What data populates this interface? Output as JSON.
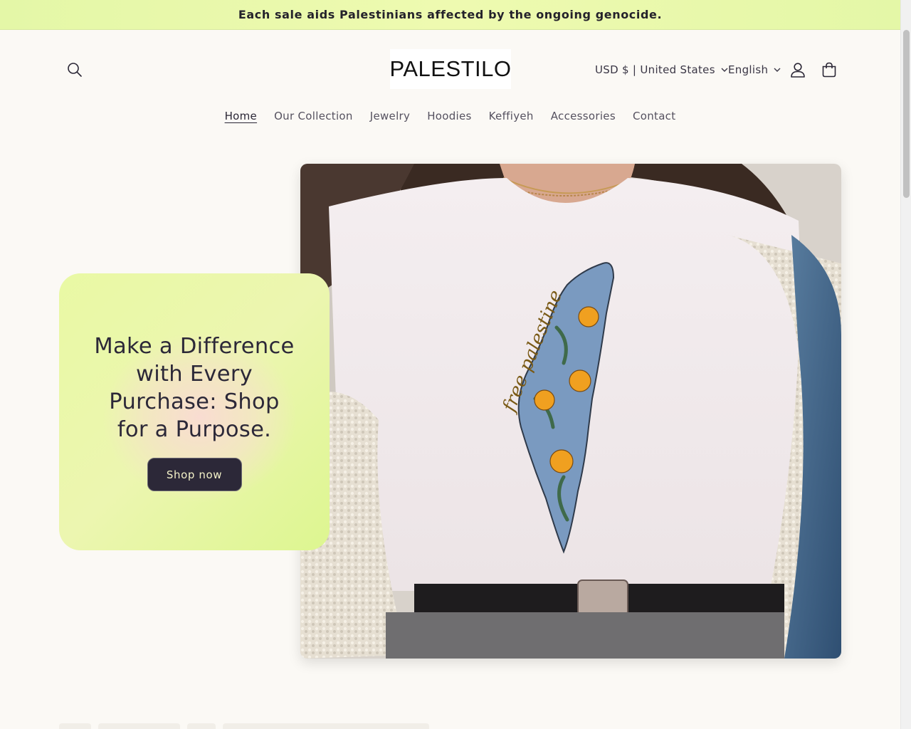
{
  "announcement": {
    "text": "Each sale aids Palestinians affected by the ongoing genocide."
  },
  "header": {
    "logo_text": "PALESTILO",
    "currency_label": "USD $ | United States",
    "language_label": "English",
    "icons": {
      "search": "search-icon",
      "account": "account-icon",
      "cart": "cart-icon",
      "chevron": "chevron-down-icon"
    }
  },
  "nav": {
    "items": [
      {
        "label": "Home",
        "active": true
      },
      {
        "label": "Our Collection",
        "active": false
      },
      {
        "label": "Jewelry",
        "active": false
      },
      {
        "label": "Hoodies",
        "active": false
      },
      {
        "label": "Keffiyeh",
        "active": false
      },
      {
        "label": "Accessories",
        "active": false
      },
      {
        "label": "Contact",
        "active": false
      }
    ]
  },
  "hero": {
    "heading": "Make a Difference with Every Purchase: Shop for a Purpose.",
    "button_label": "Shop now",
    "image_text": "free palestine"
  },
  "colors": {
    "announcement_bg": "#e9f8ab",
    "text_dark": "#2a2635",
    "button_bg": "#2c2838",
    "button_text": "#f3f1c8",
    "page_bg": "#fbf9f5"
  }
}
